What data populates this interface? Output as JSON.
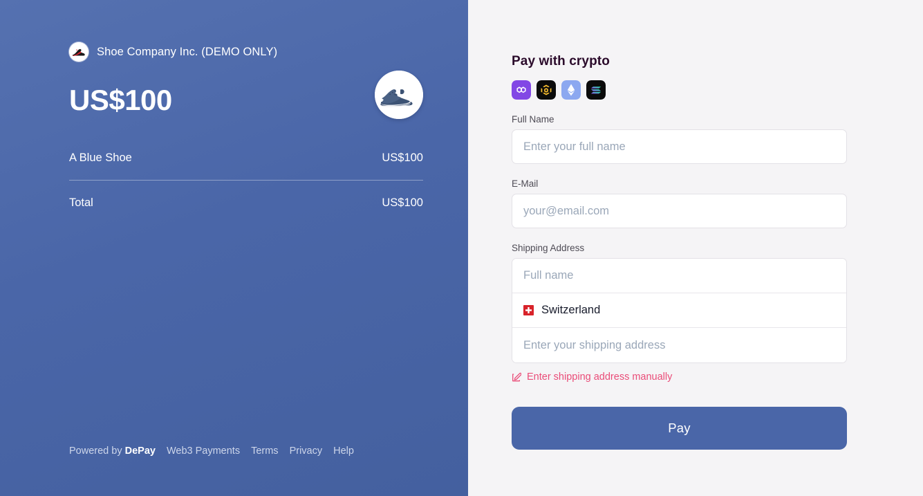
{
  "theme": {
    "panel_blue": "#4a66a8",
    "right_bg": "#f5f4f6",
    "accent_pink": "#ea4c78",
    "title_color": "#2b0b2b"
  },
  "left": {
    "merchant": {
      "name": "Shoe Company Inc. (DEMO ONLY)",
      "logo_icon": "shoe-logo-icon"
    },
    "amount": "US$100",
    "product_image_icon": "blue-shoe-product-image",
    "lines": [
      {
        "label": "A Blue Shoe",
        "value": "US$100"
      }
    ],
    "total": {
      "label": "Total",
      "value": "US$100"
    },
    "footer": {
      "powered_prefix": "Powered by ",
      "powered_brand": "DePay",
      "links": [
        "Web3 Payments",
        "Terms",
        "Privacy",
        "Help"
      ]
    }
  },
  "right": {
    "title": "Pay with crypto",
    "chains": [
      {
        "name": "polygon-icon",
        "label": "Polygon"
      },
      {
        "name": "bnb-icon",
        "label": "BNB Smart Chain"
      },
      {
        "name": "ethereum-icon",
        "label": "Ethereum"
      },
      {
        "name": "solana-icon",
        "label": "Solana"
      }
    ],
    "full_name": {
      "label": "Full Name",
      "value": "",
      "placeholder": "Enter your full name"
    },
    "email": {
      "label": "E-Mail",
      "value": "",
      "placeholder": "your@email.com"
    },
    "shipping": {
      "label": "Shipping Address",
      "name_field": {
        "value": "",
        "placeholder": "Full name"
      },
      "country": {
        "value": "Switzerland",
        "flag_icon": "flag-switzerland-icon"
      },
      "address_field": {
        "value": "",
        "placeholder": "Enter your shipping address"
      },
      "manual_link": {
        "label": "Enter shipping address manually",
        "icon": "edit-pencil-icon"
      }
    },
    "pay_button": "Pay"
  }
}
